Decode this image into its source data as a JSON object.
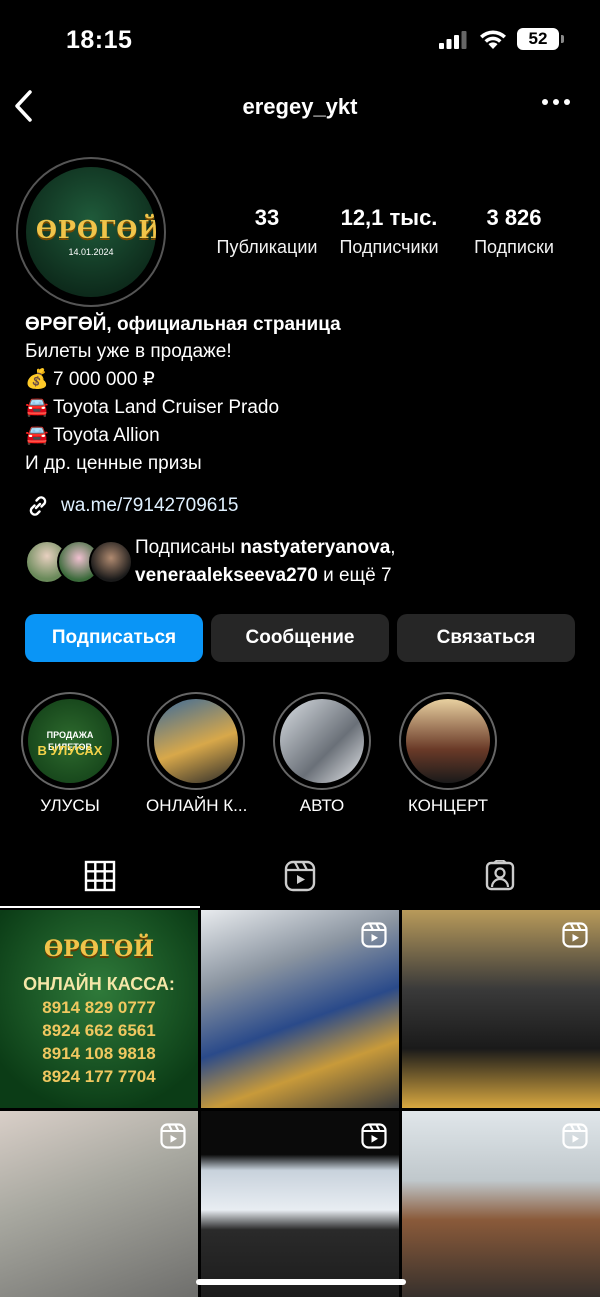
{
  "status_bar": {
    "time": "18:15",
    "battery": "52"
  },
  "header": {
    "username": "eregey_ykt"
  },
  "profile": {
    "avatar_logo": "ӨРӨГӨЙ",
    "avatar_date": "14.01.2024",
    "stats": [
      {
        "value": "33",
        "label": "Публикации"
      },
      {
        "value": "12,1 тыс.",
        "label": "Подписчики"
      },
      {
        "value": "3 826",
        "label": "Подписки"
      }
    ],
    "name": "ӨРӨГӨЙ, официальная страница",
    "bio": [
      {
        "emoji": "",
        "text": "Билеты уже в продаже!"
      },
      {
        "emoji": "💰",
        "text": "7 000 000 ₽"
      },
      {
        "emoji": "🚘",
        "text": "Toyota Land Cruiser Prado"
      },
      {
        "emoji": "🚘",
        "text": "Toyota Allion"
      },
      {
        "emoji": "",
        "text": "И др. ценные призы"
      }
    ],
    "link": "wa.me/79142709615",
    "followed_by": {
      "prefix": "Подписаны ",
      "user1": "nastyateryanova",
      "sep": ",",
      "user2": "veneraalekseeva270",
      "suffix": " и ещё 7"
    }
  },
  "actions": {
    "follow": "Подписаться",
    "message": "Сообщение",
    "contact": "Связаться"
  },
  "highlights": [
    {
      "label": "УЛУСЫ",
      "cover_text": "ПРОДАЖА БИЛЕТОВ",
      "cover_text2": "В УЛУСАХ"
    },
    {
      "label": "ОНЛАЙН К..."
    },
    {
      "label": "АВТО"
    },
    {
      "label": "КОНЦЕРТ"
    }
  ],
  "posts": {
    "first": {
      "logo": "ӨРӨГӨЙ",
      "title": "ОНЛАЙН КАССА:",
      "phones": [
        "8914 829 0777",
        "8924 662 6561",
        "8914 108 9818",
        "8924 177 7704"
      ]
    }
  },
  "colors": {
    "primary_button": "#0a95f6",
    "secondary_button": "#262626",
    "background": "#000000"
  },
  "icons": [
    "back-icon",
    "more-icon",
    "link-icon",
    "grid-icon",
    "reels-icon",
    "tagged-icon"
  ]
}
